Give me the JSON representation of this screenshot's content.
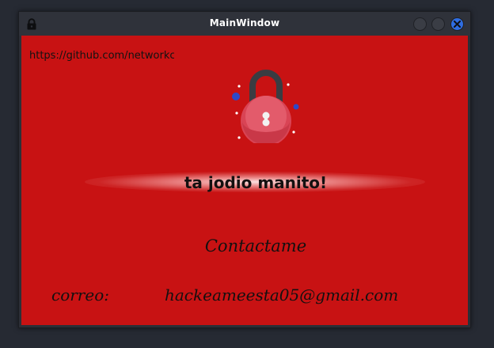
{
  "window": {
    "title": "MainWindow",
    "icon": "lock-icon",
    "controls": [
      "minimize-button",
      "maximize-button",
      "close-button"
    ],
    "accent": "#2f6de1"
  },
  "content": {
    "background": "#c81213",
    "url_text": "https://github.com/networkchuck",
    "headline": "ta jodio manito!",
    "contact_title": "Contactame",
    "email_label": "correo:",
    "email_value": "hackeameesta05@gmail.com",
    "illustration": "padlock-icon"
  }
}
